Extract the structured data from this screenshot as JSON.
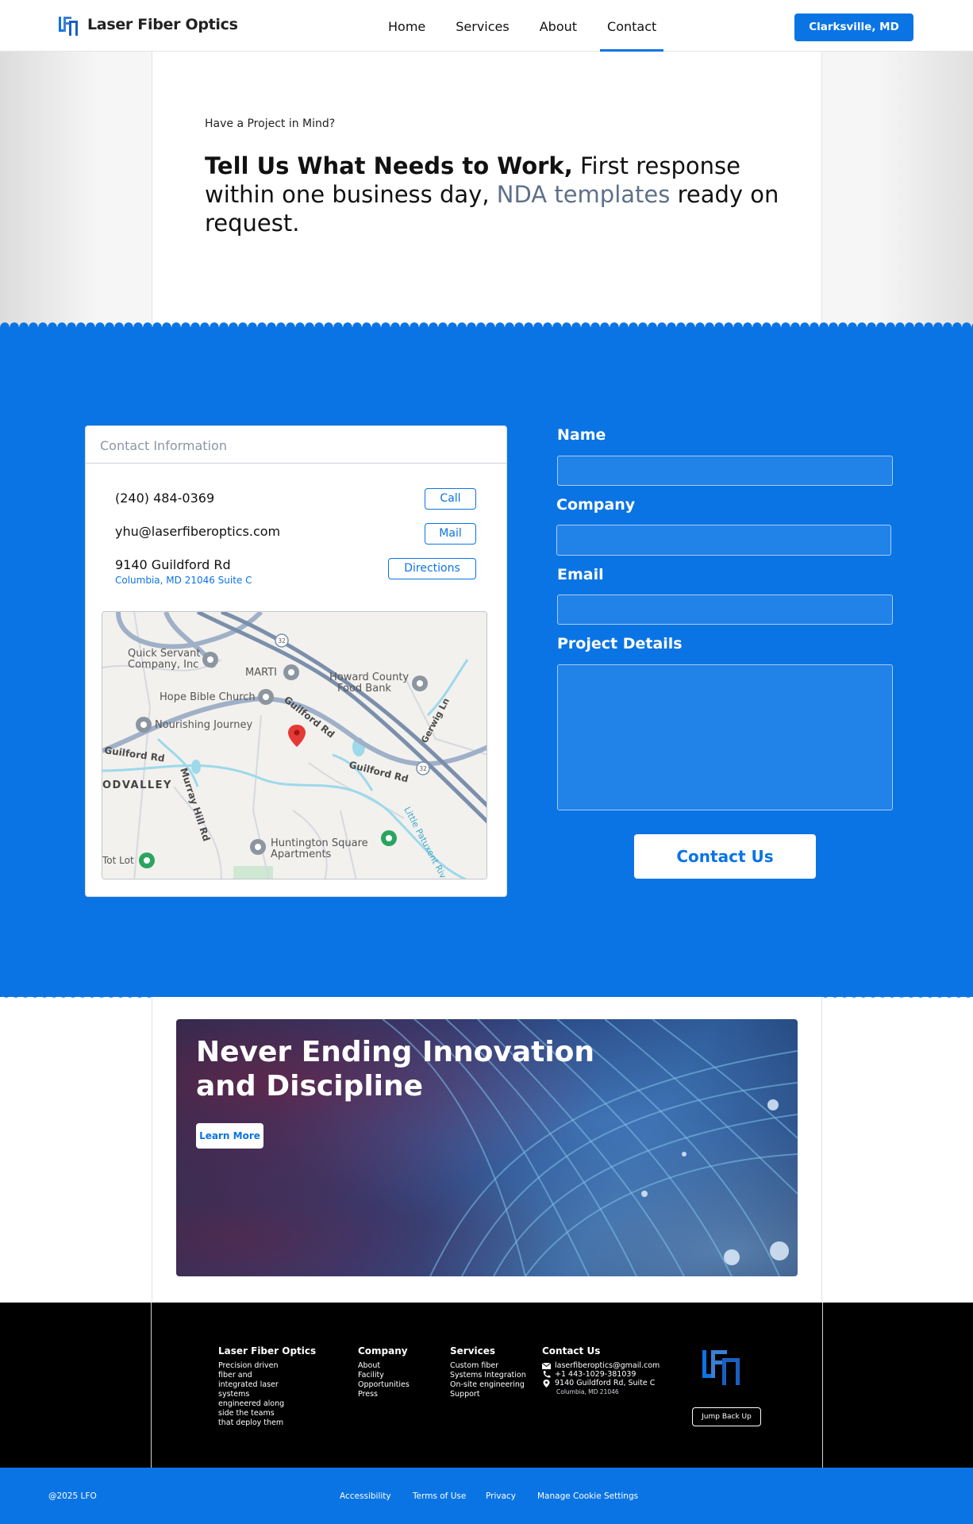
{
  "header": {
    "brand_name": "Laser Fiber Optics",
    "nav": [
      "Home",
      "Services",
      "About",
      "Contact"
    ],
    "active_nav": "Contact",
    "location_button": "Clarksville, MD"
  },
  "hero": {
    "eyebrow": "Have a Project in Mind?",
    "headline_bold": "Tell Us What Needs to Work,",
    "headline_rest_1": " First response within one business day, ",
    "headline_link": "NDA templates",
    "headline_rest_2": " ready on request."
  },
  "contact_info": {
    "title": "Contact Information",
    "phone": "(240) 484-0369",
    "phone_action": "Call",
    "email": "yhu@laserfiberoptics.com",
    "email_action": "Mail",
    "address_line1": "9140 Guildford Rd",
    "address_line2": "Columbia, MD 21046 Suite C",
    "address_action": "Directions"
  },
  "map": {
    "labels": {
      "quick_servant": "Quick Servant",
      "quick_servant_2": "Company, Inc",
      "marti": "MARTI",
      "howard": "Howard County",
      "howard_2": "Food Bank",
      "hope": "Hope Bible Church",
      "nourishing": "Nourishing Journey",
      "guilford_rd": "Guilford Rd",
      "guilford_rd_2": "Guilford Rd",
      "guilford_rd_3": "Guilford Rd",
      "gerwig": "Gerwig Ln",
      "dvalley": "ODVALLEY",
      "murray": "Murray Hill Rd",
      "huntington": "Huntington Square",
      "huntington_2": "Apartments",
      "little_patuxent": "Little Patuxent Riv",
      "tot_lot": "Tot Lot",
      "route": "32"
    }
  },
  "form": {
    "name_label": "Name",
    "company_label": "Company",
    "email_label": "Email",
    "details_label": "Project Details",
    "submit": "Contact Us"
  },
  "promo": {
    "title": "Never Ending Innovation and Discipline",
    "button": "Learn More"
  },
  "footer": {
    "brand": {
      "title": "Laser Fiber Optics",
      "lines": [
        "Precision driven",
        "fiber and",
        "integrated laser",
        "systems",
        "engineered along",
        "side the teams",
        "that deploy them"
      ]
    },
    "company": {
      "title": "Company",
      "items": [
        "About",
        "Facility",
        "Opportunities",
        "Press"
      ]
    },
    "services": {
      "title": "Services",
      "items": [
        "Custom fiber",
        "Systems Integration",
        "On-site engineering",
        "Support"
      ]
    },
    "contact": {
      "title": "Contact Us",
      "email": "laserfiberoptics@gmail.com",
      "phone": "+1 443-1029-381039",
      "address": "9140 Guildford Rd, Suite C",
      "address_sub": "Columbia, MD 21046"
    },
    "jump_button": "Jump Back Up"
  },
  "bottom_bar": {
    "copyright": "@2025 LFO",
    "links": [
      "Accessibility",
      "Terms of Use",
      "Privacy",
      "Manage Cookie Settings"
    ]
  },
  "colors": {
    "accent": "#0b74e4",
    "footer_bg": "#000000",
    "hero_link": "#5e7188"
  },
  "icons": [
    "lfo-logo-icon",
    "map-pin-icon",
    "envelope-icon",
    "phone-icon",
    "location-icon"
  ]
}
